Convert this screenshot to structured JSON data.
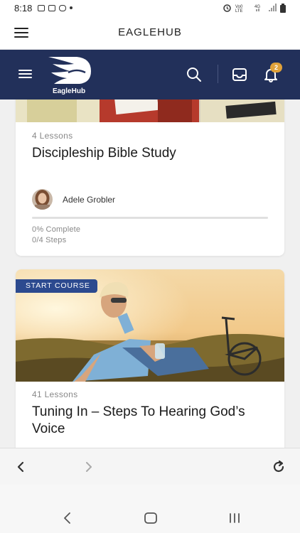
{
  "status_bar": {
    "time": "8:18"
  },
  "browser": {
    "title": "EAGLEHUB"
  },
  "header": {
    "logo_text": "EagleHub",
    "notification_count": "2"
  },
  "courses": [
    {
      "lessons": "4 Lessons",
      "title": "Discipleship Bible Study",
      "author": "Adele Grobler",
      "progress": 0,
      "progress_label": "0% Complete",
      "steps": "0/4 Steps"
    },
    {
      "badge": "START COURSE",
      "lessons": "41 Lessons",
      "title": "Tuning In – Steps To Hearing God’s Voice"
    }
  ],
  "colors": {
    "header_bg": "#22305a",
    "badge_bg": "#2c4a8f",
    "notification": "#e1a23a"
  }
}
